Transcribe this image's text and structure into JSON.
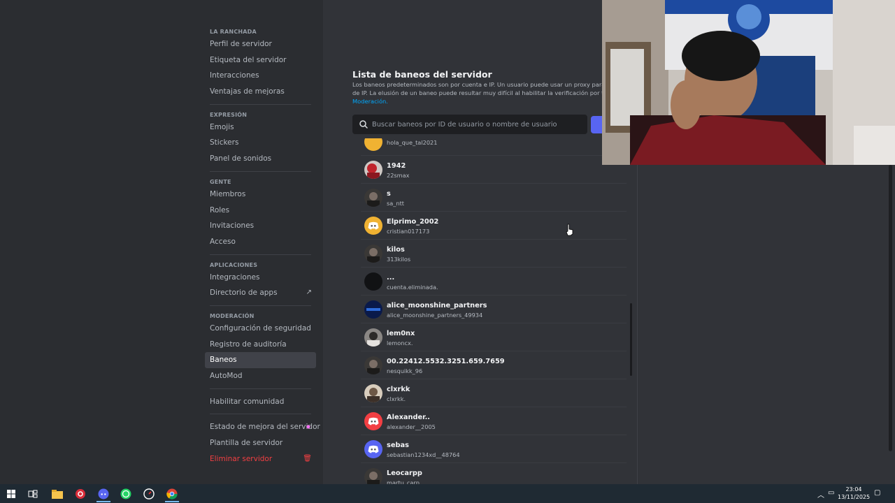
{
  "sidebar": {
    "sections": [
      {
        "header": "LA RANCHADA",
        "items": [
          "Perfil de servidor",
          "Etiqueta del servidor",
          "Interacciones",
          "Ventajas de mejoras"
        ]
      },
      {
        "header": "EXPRESIÓN",
        "items": [
          "Emojis",
          "Stickers",
          "Panel de sonidos"
        ]
      },
      {
        "header": "GENTE",
        "items": [
          "Miembros",
          "Roles",
          "Invitaciones",
          "Acceso"
        ]
      },
      {
        "header": "APLICACIONES",
        "items": [
          "Integraciones",
          "Directorio de apps"
        ]
      },
      {
        "header": "MODERACIÓN",
        "items": [
          "Configuración de seguridad",
          "Registro de auditoría",
          "Baneos",
          "AutoMod"
        ]
      }
    ],
    "community": "Habilitar comunidad",
    "boost_status": "Estado de mejora del servidor",
    "template": "Plantilla de servidor",
    "delete": "Eliminar servidor",
    "active_item": "Baneos"
  },
  "main": {
    "title": "Lista de baneos del servidor",
    "desc_line1": "Los baneos predeterminados son por cuenta e IP. Un usuario puede usar un proxy para eludir",
    "desc_line2": "de IP. La elusión de un baneo puede resultar muy difícil al habilitar la verificación por teléfono",
    "desc_link": "Moderación.",
    "search_placeholder": "Buscar baneos por ID de usuario o nombre de usuario"
  },
  "bans": [
    {
      "name": "",
      "handle": "hola_que_tal2021",
      "avatar": "yellow"
    },
    {
      "name": "1942",
      "handle": "22smax",
      "avatar": "photo-red"
    },
    {
      "name": "s",
      "handle": "sa_ntt",
      "avatar": "photo-dark"
    },
    {
      "name": "Elprimo_2002",
      "handle": "cristian017173",
      "avatar": "discord-yellow"
    },
    {
      "name": "kilos",
      "handle": "313kilos",
      "avatar": "photo-dark"
    },
    {
      "name": "...",
      "handle": "cuenta.eliminada.",
      "avatar": "black"
    },
    {
      "name": "alice_moonshine_partners",
      "handle": "alice_moonshine_partners_49934",
      "avatar": "navy"
    },
    {
      "name": "lem0nx",
      "handle": "lemoncx.",
      "avatar": "photo-gray"
    },
    {
      "name": "00.22412.5532.3251.659.7659",
      "handle": "nesquikk_96",
      "avatar": "photo-dark"
    },
    {
      "name": "clxrkk",
      "handle": "clxrkk.",
      "avatar": "photo-beige"
    },
    {
      "name": "Alexander..",
      "handle": "alexander__2005",
      "avatar": "discord-red"
    },
    {
      "name": "sebas",
      "handle": "sebastian1234xd__48764",
      "avatar": "discord-blurple"
    },
    {
      "name": "Leocarpp",
      "handle": "martu_carp",
      "avatar": "photo-dark"
    }
  ],
  "taskbar": {
    "time": "23:04",
    "date": "13/11/2025"
  },
  "colors": {
    "accent": "#5865f2",
    "danger": "#f23f42",
    "link": "#00a8fc",
    "boost": "#ff73fa"
  }
}
